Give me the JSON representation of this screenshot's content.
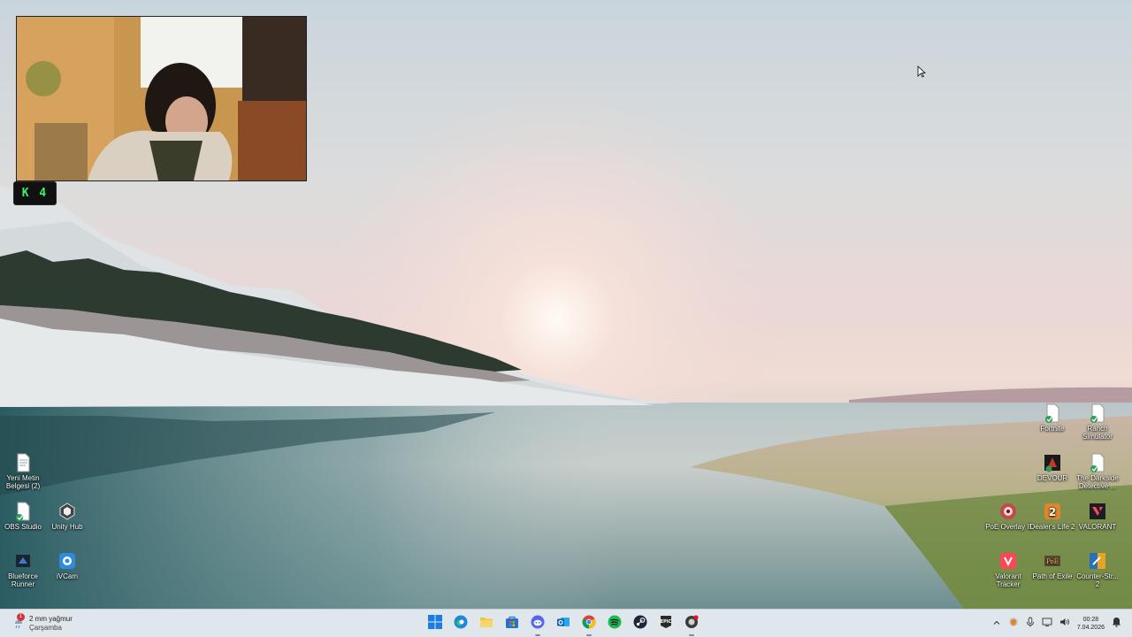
{
  "webcam": {
    "badge": "K 4"
  },
  "desktop_icons_left": [
    {
      "label": "Yeni Metin Belgesi (2)",
      "icon": "text-file-icon"
    },
    {
      "label": "OBS Studio",
      "icon": "obs-icon"
    },
    {
      "label": "Unity Hub",
      "icon": "unity-icon"
    },
    {
      "label": "Blueforce Runner",
      "icon": "game-icon"
    },
    {
      "label": "iVCam",
      "icon": "ivcam-icon"
    }
  ],
  "desktop_icons_right": [
    {
      "label": "Fortnite",
      "icon": "file-icon"
    },
    {
      "label": "Ranch Simulator",
      "icon": "file-icon"
    },
    {
      "label": "DEVOUR",
      "icon": "devour-icon"
    },
    {
      "label": "The Darkside Detective ...",
      "icon": "file-icon"
    },
    {
      "label": "PoE Overlay II",
      "icon": "poe-overlay-icon"
    },
    {
      "label": "Dealer's Life 2",
      "icon": "dealers-life-icon"
    },
    {
      "label": "VALORANT",
      "icon": "valorant-icon"
    },
    {
      "label": "Valorant Tracker",
      "icon": "valorant-tracker-icon"
    },
    {
      "label": "Path of Exile",
      "icon": "path-of-exile-icon"
    },
    {
      "label": "Counter-Str... 2",
      "icon": "counter-strike-icon"
    }
  ],
  "taskbar": {
    "weather": {
      "title": "2 mm yağmur",
      "subtitle": "Çarşamba",
      "badge": "1"
    },
    "apps": [
      {
        "name": "start-button",
        "icon": "windows-icon"
      },
      {
        "name": "edge-button",
        "icon": "edge-icon"
      },
      {
        "name": "file-explorer-button",
        "icon": "folder-icon"
      },
      {
        "name": "store-button",
        "icon": "store-icon"
      },
      {
        "name": "discord-button",
        "icon": "discord-icon"
      },
      {
        "name": "outlook-button",
        "icon": "outlook-icon"
      },
      {
        "name": "chrome-button",
        "icon": "chrome-icon"
      },
      {
        "name": "spotify-button",
        "icon": "spotify-icon"
      },
      {
        "name": "steam-button",
        "icon": "steam-icon"
      },
      {
        "name": "epic-games-button",
        "icon": "epic-games-icon"
      },
      {
        "name": "recorder-button",
        "icon": "recorder-icon"
      }
    ],
    "clock": {
      "time": "00:28",
      "date": "7.04.2026"
    }
  }
}
